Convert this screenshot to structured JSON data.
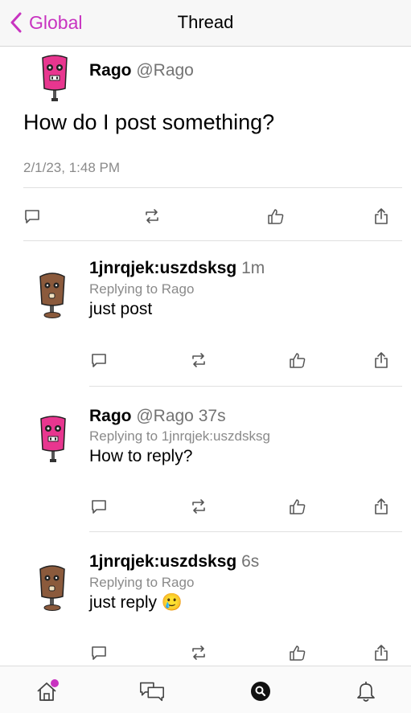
{
  "header": {
    "back_label": "Global",
    "title": "Thread"
  },
  "main_post": {
    "name": "Rago",
    "handle": "@Rago",
    "text": "How do I post something?",
    "date": "2/1/23, 1:48 PM",
    "avatar": "pink-robot-avatar"
  },
  "replies": [
    {
      "name": "1jnrqjek:uszdsksg",
      "handle": "",
      "time": "1m",
      "replying_to": "Replying to Rago",
      "text": "just post",
      "avatar": "brown-robot-avatar"
    },
    {
      "name": "Rago",
      "handle": "@Rago",
      "time": "37s",
      "replying_to": "Replying to 1jnrqjek:uszdsksg",
      "text": "How to reply?",
      "avatar": "pink-robot-avatar"
    },
    {
      "name": "1jnrqjek:uszdsksg",
      "handle": "",
      "time": "6s",
      "replying_to": "Replying to Rago",
      "text": "just reply",
      "emoji": "🥲",
      "avatar": "brown-robot-avatar"
    }
  ],
  "actions": [
    "comment-icon",
    "repost-icon",
    "like-icon",
    "share-icon"
  ],
  "tabbar": [
    "home-icon",
    "messages-icon",
    "search-icon",
    "bell-icon"
  ],
  "colors": {
    "accent": "#c833c0",
    "muted": "#8a8a8a",
    "pink_robot": "#e8368f",
    "brown_robot": "#8b5a3c"
  }
}
